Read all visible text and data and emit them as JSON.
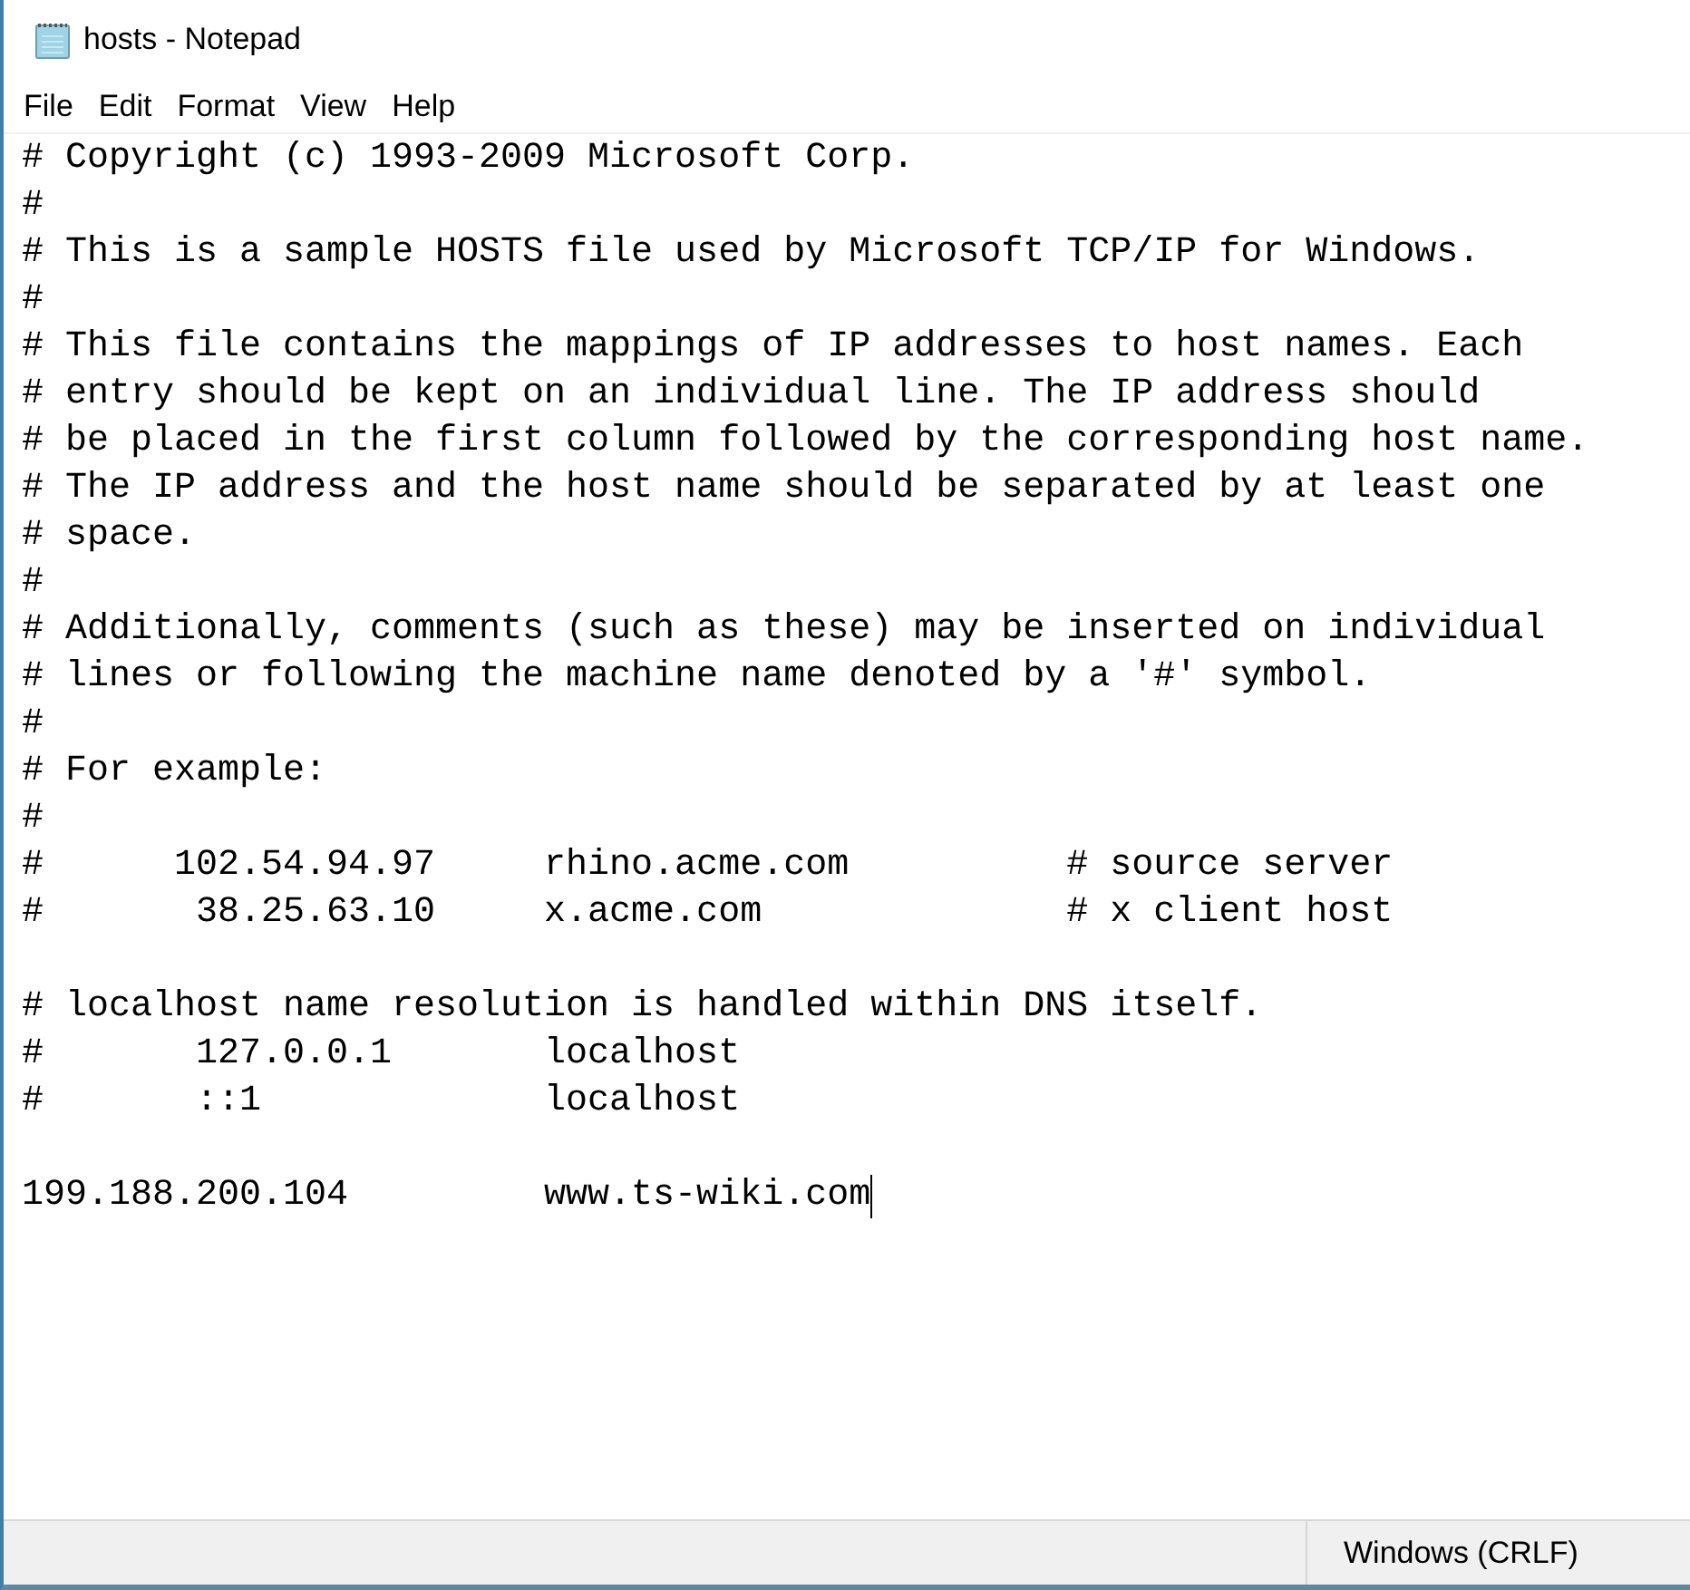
{
  "window": {
    "title": "hosts - Notepad"
  },
  "menu": [
    "File",
    "Edit",
    "Format",
    "View",
    "Help"
  ],
  "editor": {
    "caret": true,
    "blocks": [
      [
        "# Copyright (c) 1993-2009 Microsoft Corp.",
        "#",
        "# This is a sample HOSTS file used by Microsoft TCP/IP for Windows.",
        "#",
        "# This file contains the mappings of IP addresses to host names. Each",
        "# entry should be kept on an individual line. The IP address should",
        "# be placed in the first column followed by the corresponding host name.",
        "# The IP address and the host name should be separated by at least one",
        "# space.",
        "#",
        "# Additionally, comments (such as these) may be inserted on individual",
        "# lines or following the machine name denoted by a '#' symbol.",
        "#",
        "# For example:",
        "#",
        "#      102.54.94.97     rhino.acme.com          # source server",
        "#       38.25.63.10     x.acme.com              # x client host"
      ],
      [
        "# localhost name resolution is handled within DNS itself.",
        "#       127.0.0.1       localhost",
        "#       ::1             localhost"
      ],
      [
        "199.188.200.104         www.ts-wiki.com"
      ]
    ]
  },
  "status_bar": {
    "line_ending": "Windows (CRLF)"
  }
}
